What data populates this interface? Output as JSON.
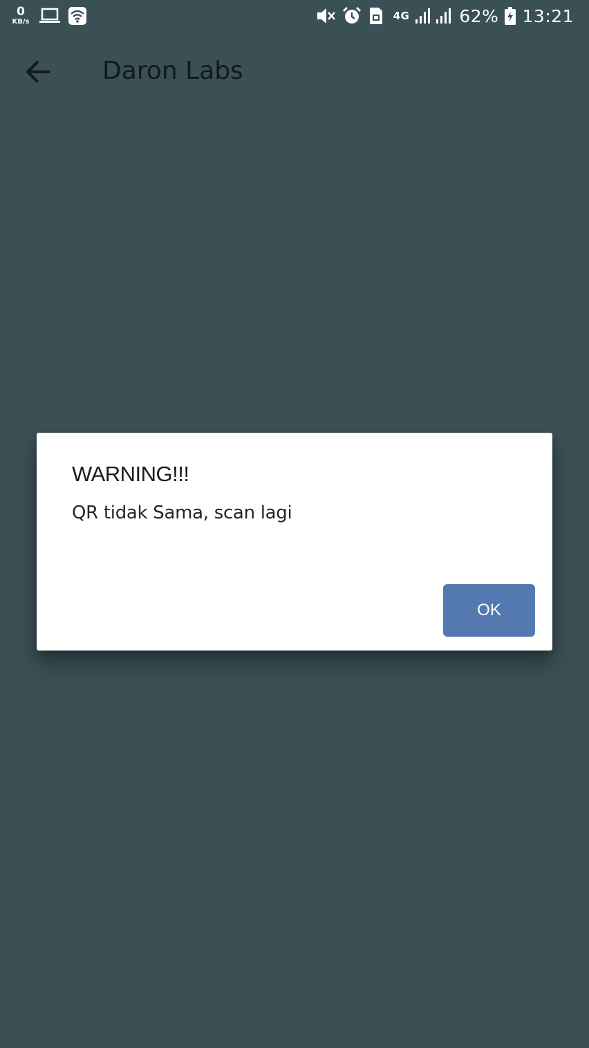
{
  "status_bar": {
    "net_speed_value": "0",
    "net_speed_unit": "KB/s",
    "network_type": "4G",
    "battery_percent": "62%",
    "time": "13:21",
    "icons": [
      "laptop-icon",
      "wifi-icon",
      "mute-icon",
      "alarm-icon",
      "sim-icon",
      "signal-icon",
      "battery-icon"
    ]
  },
  "app_bar": {
    "title": "Daron Labs",
    "back_icon": "arrow-left-icon"
  },
  "dialog": {
    "title": "WARNING!!!",
    "message": "QR tidak Sama, scan lagi",
    "ok_label": "OK"
  },
  "colors": {
    "background": "#3a5055",
    "dialog_background": "#ffffff",
    "button": "#5379b0"
  }
}
